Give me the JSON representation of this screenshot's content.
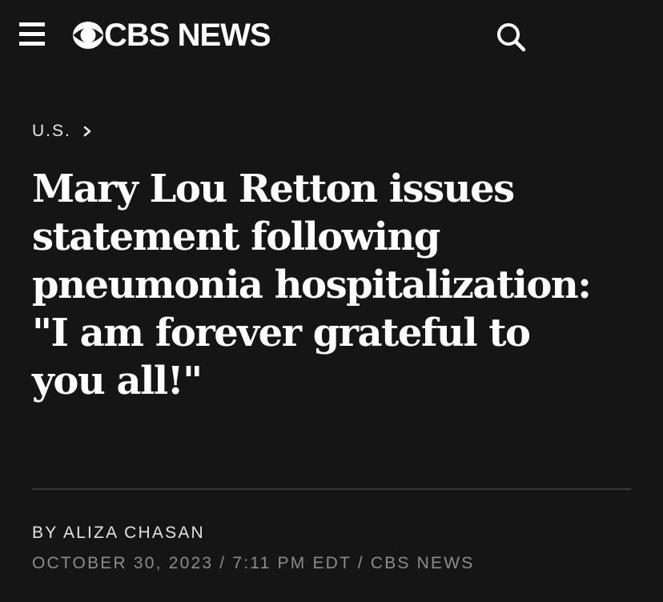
{
  "header": {
    "brand": "CBS NEWS",
    "menu_icon": "hamburger-menu-icon",
    "logo_icon": "cbs-eye-logo-icon",
    "search_icon": "search-icon"
  },
  "article": {
    "section": "U.S.",
    "section_icon": "chevron-right-icon",
    "headline": "Mary Lou Retton issues statement following pneumonia hospitalization: \"I am forever grateful to you all!\"",
    "byline_prefix": "BY",
    "author": "ALIZA CHASAN",
    "date": "OCTOBER 30, 2023",
    "time": "7:11 PM EDT",
    "source": "CBS NEWS",
    "separator": "/"
  },
  "colors": {
    "background": "#151515",
    "text": "#ffffff",
    "meta": "#8c8c8c",
    "divider": "#3a3a3a"
  }
}
